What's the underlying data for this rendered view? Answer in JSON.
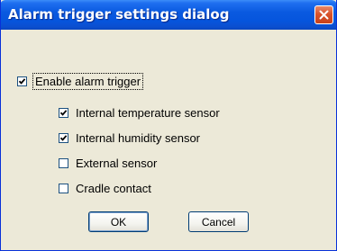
{
  "window": {
    "title": "Alarm trigger settings dialog",
    "close_icon": "close-icon"
  },
  "main_option": {
    "label": "Enable alarm trigger",
    "checked": true
  },
  "sub_options": [
    {
      "label": "Internal temperature sensor",
      "checked": true
    },
    {
      "label": "Internal humidity sensor",
      "checked": true
    },
    {
      "label": "External sensor",
      "checked": false
    },
    {
      "label": "Cradle contact",
      "checked": false
    }
  ],
  "buttons": {
    "ok_label": "OK",
    "cancel_label": "Cancel"
  },
  "colors": {
    "title_bar": "#0655dd",
    "close_button": "#d9532c",
    "dialog_background": "#ece9d8",
    "checkbox_border": "#1c5180"
  }
}
